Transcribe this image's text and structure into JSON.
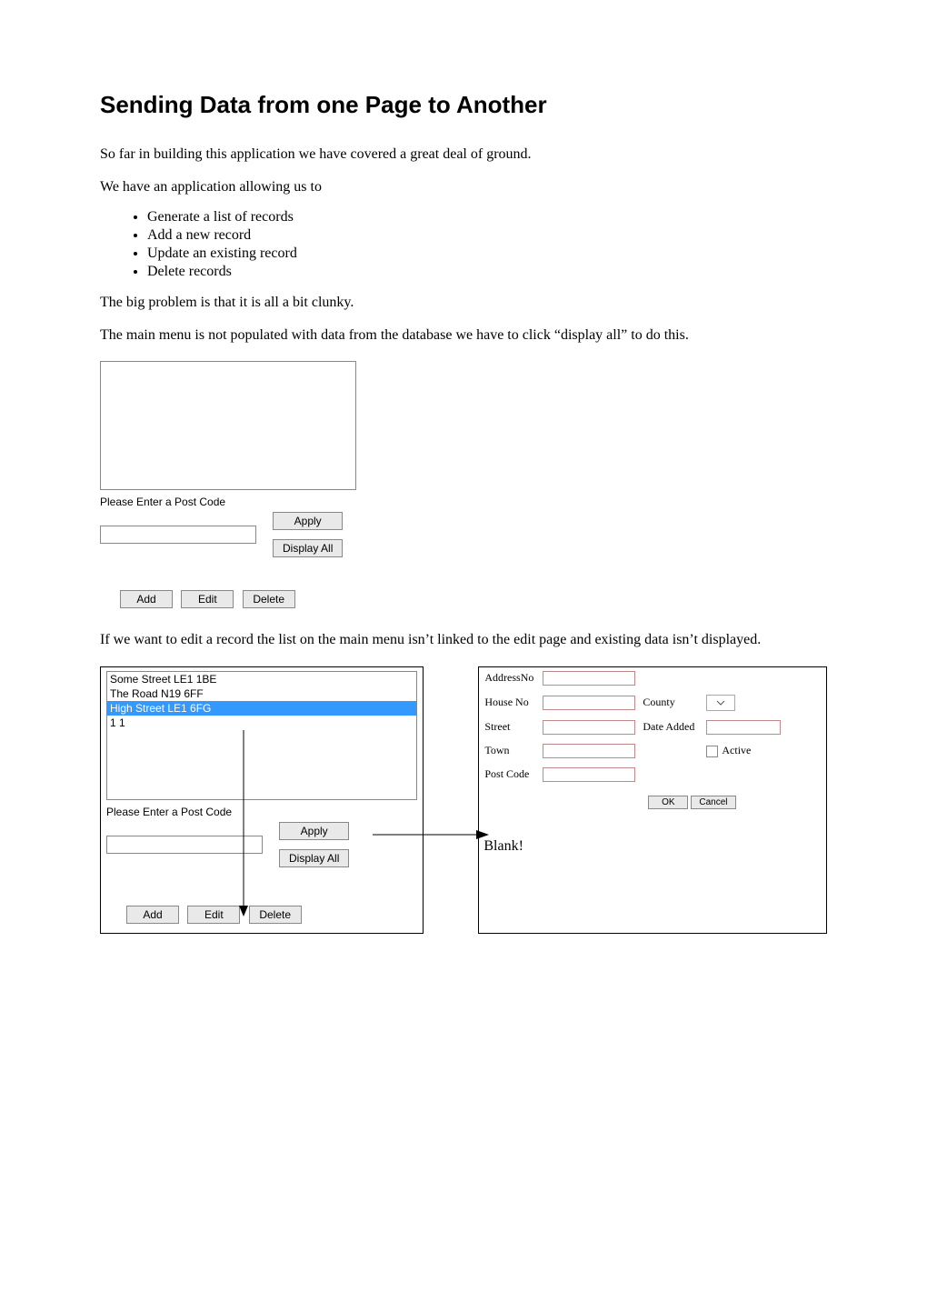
{
  "title": "Sending Data from one Page to Another",
  "para1": "So far in building this application we have covered a great deal of ground.",
  "para2": "We have an application allowing us to",
  "bullets": [
    "Generate a list of records",
    "Add a new record",
    "Update an existing record",
    "Delete records"
  ],
  "para3": "The big problem is that it is all a bit clunky.",
  "para4": "The main menu is not populated with data from the database we have to click “display all” to do this.",
  "panel1": {
    "label": "Please Enter a Post Code",
    "apply": "Apply",
    "display_all": "Display All",
    "add": "Add",
    "edit": "Edit",
    "del": "Delete"
  },
  "para5": "If we want to edit a record the list on the main menu isn’t linked to the edit page and existing data isn’t displayed.",
  "list_items": [
    "Some Street LE1 1BE",
    "The Road N19 6FF",
    "High Street LE1 6FG",
    "1 1"
  ],
  "selected_index": 2,
  "form": {
    "addressno": "AddressNo",
    "houseno": "House No",
    "street": "Street",
    "town": "Town",
    "postcode": "Post Code",
    "county": "County",
    "dateadded": "Date Added",
    "active": "Active",
    "ok": "OK",
    "cancel": "Cancel"
  },
  "blank_label": "Blank!"
}
